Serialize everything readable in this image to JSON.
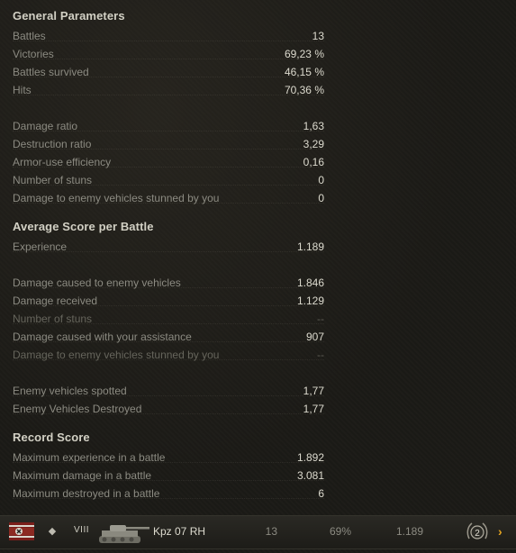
{
  "sections": {
    "general": {
      "title": "General Parameters",
      "rows": [
        {
          "label": "Battles",
          "value": "13"
        },
        {
          "label": "Victories",
          "value": "69,23 %"
        },
        {
          "label": "Battles survived",
          "value": "46,15 %"
        },
        {
          "label": "Hits",
          "value": "70,36 %"
        },
        {
          "label": "Damage ratio",
          "value": "1,63"
        },
        {
          "label": "Destruction ratio",
          "value": "3,29"
        },
        {
          "label": "Armor-use efficiency",
          "value": "0,16"
        },
        {
          "label": "Number of stuns",
          "value": "0"
        },
        {
          "label": "Damage to enemy vehicles stunned by you",
          "value": "0"
        }
      ]
    },
    "average": {
      "title": "Average Score per Battle",
      "rows": [
        {
          "label": "Experience",
          "value": "1.189"
        },
        {
          "label": "Damage caused to enemy vehicles",
          "value": "1.846"
        },
        {
          "label": "Damage received",
          "value": "1.129"
        },
        {
          "label": "Number of stuns",
          "value": "--"
        },
        {
          "label": "Damage caused with your assistance",
          "value": "907"
        },
        {
          "label": "Damage to enemy vehicles stunned by you",
          "value": "--"
        },
        {
          "label": "Enemy vehicles spotted",
          "value": "1,77"
        },
        {
          "label": "Enemy Vehicles Destroyed",
          "value": "1,77"
        }
      ]
    },
    "record": {
      "title": "Record Score",
      "rows": [
        {
          "label": "Maximum experience in a battle",
          "value": "1.892"
        },
        {
          "label": "Maximum damage in a battle",
          "value": "3.081"
        },
        {
          "label": "Maximum destroyed in a battle",
          "value": "6"
        }
      ]
    }
  },
  "vehicle": {
    "nation_flag": "germany-flag-icon",
    "class_icon": "medium-tank-icon",
    "tier": "VIII",
    "name": "Kpz 07 RH",
    "battles": "13",
    "win_rate": "69%",
    "avg_experience": "1.189",
    "mastery_badge": "2",
    "next_icon": "chevron-right-icon"
  },
  "colors": {
    "background": "#1b1a16",
    "title": "#d2d0c4",
    "label": "#8c8b82",
    "value": "#dddbcf",
    "dim": "#66655c",
    "accent": "#e3a320"
  }
}
